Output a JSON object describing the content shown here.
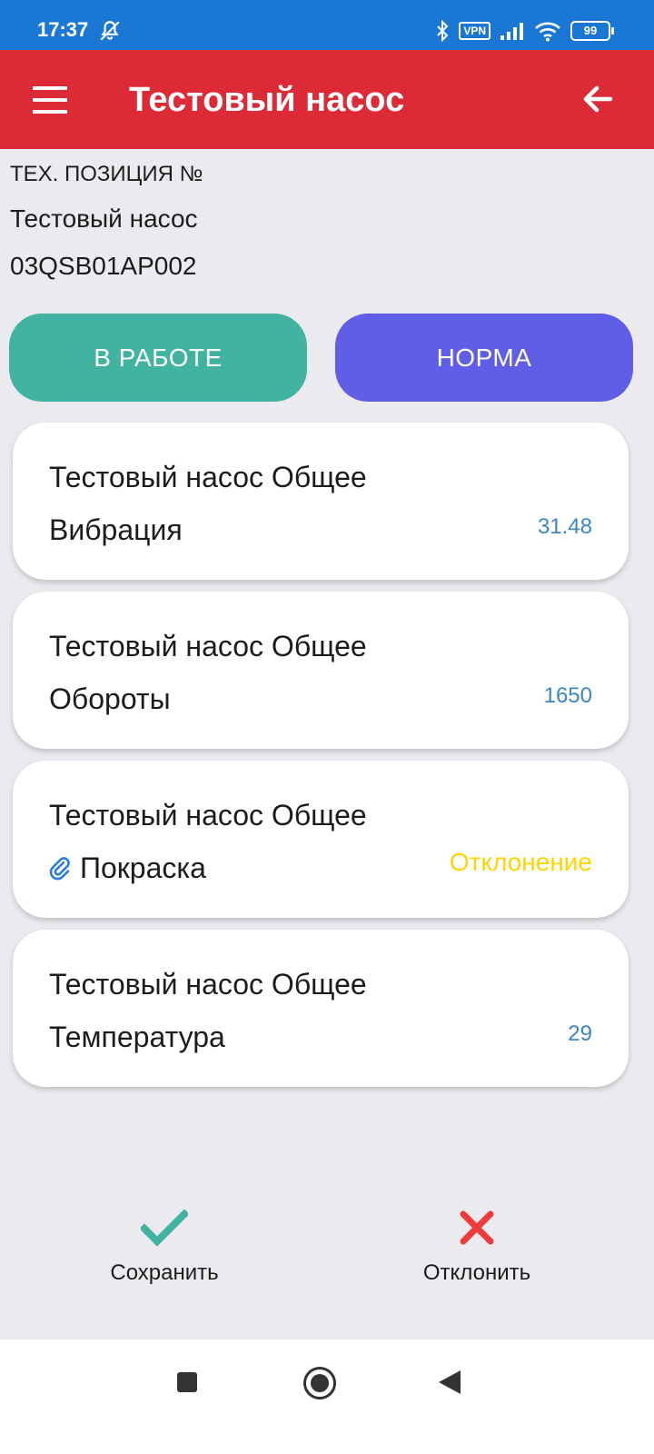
{
  "status_bar": {
    "time": "17:37",
    "vpn": "VPN",
    "battery": "99"
  },
  "app_bar": {
    "title": "Тестовый насос"
  },
  "info": {
    "position_label": "ТЕХ. ПОЗИЦИЯ №",
    "name": "Тестовый насос",
    "code": "03QSB01AP002"
  },
  "state_buttons": {
    "work": "В РАБОТЕ",
    "norm": "НОРМА",
    "work_color": "#42b3a1",
    "norm_color": "#605de6"
  },
  "cards": [
    {
      "title": "Тестовый насос Общее",
      "parameter": "Вибрация",
      "value": "31.48"
    },
    {
      "title": "Тестовый насос Общее",
      "parameter": "Обороты",
      "value": "1650"
    },
    {
      "title": "Тестовый насос Общее",
      "parameter": "Покраска",
      "value": "Отклонение",
      "has_attachment": true,
      "value_color": "#ffd400"
    },
    {
      "title": "Тестовый насос Общее",
      "parameter": "Температура",
      "value": "29"
    }
  ],
  "actions": {
    "save": "Сохранить",
    "reject": "Отклонить",
    "save_color": "#42b3a1",
    "reject_color": "#ef3b3b"
  },
  "colors": {
    "status_bar": "#1a77d4",
    "app_bar": "#dc2a37",
    "value": "#3a86c8"
  }
}
